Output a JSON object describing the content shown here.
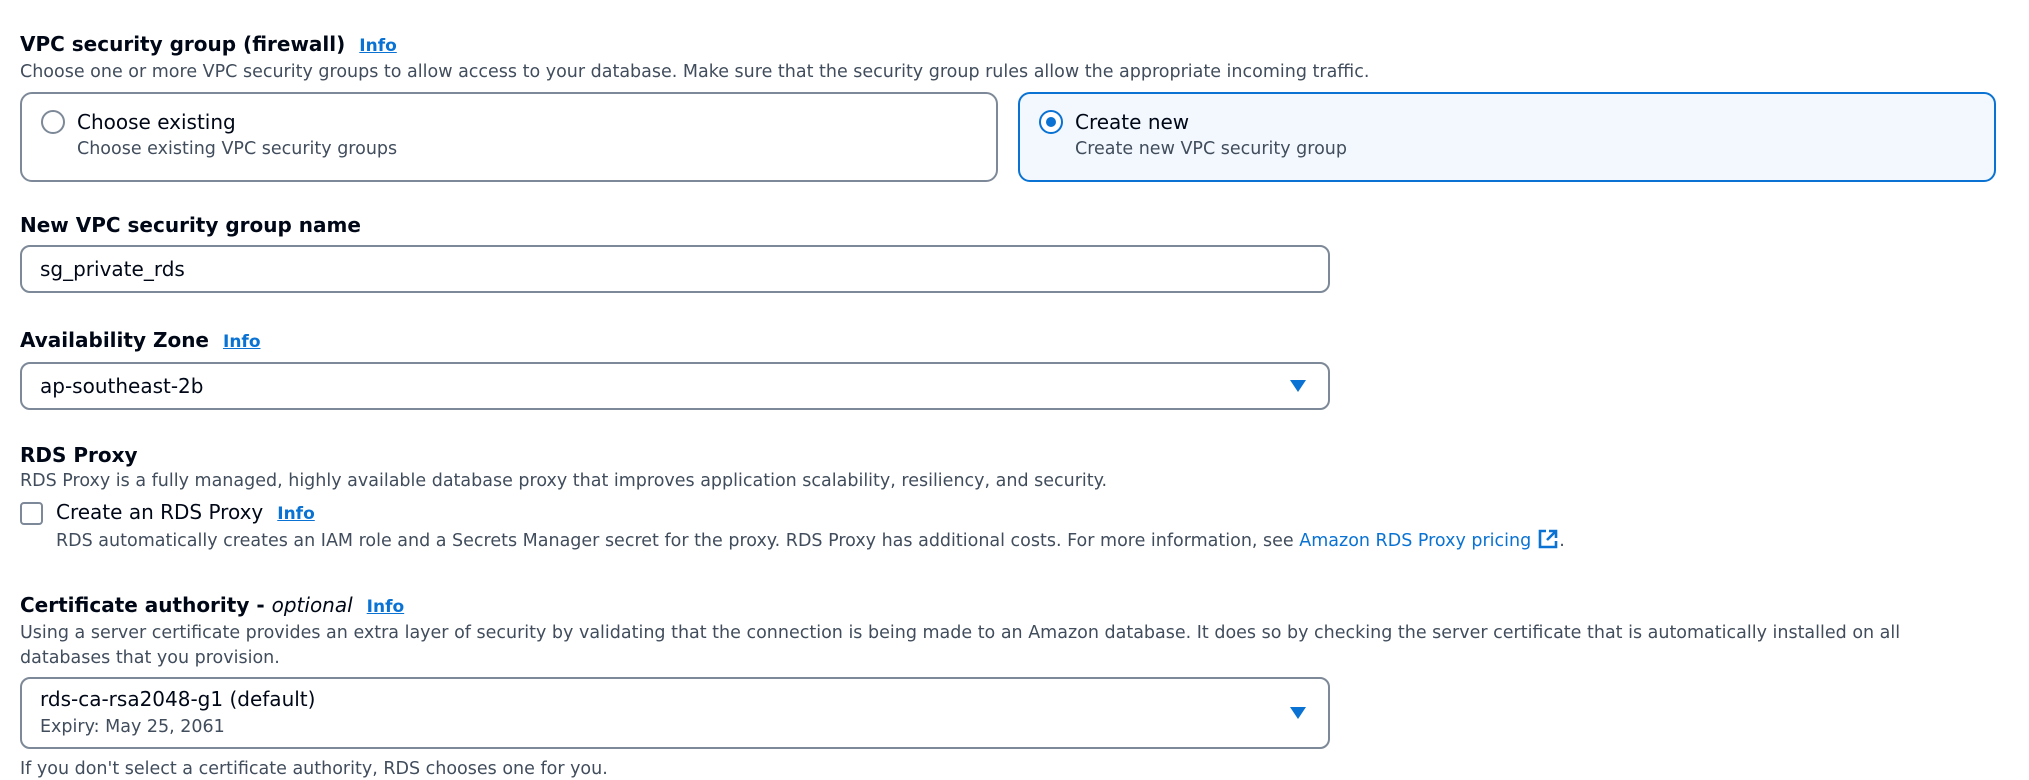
{
  "vpc_sg": {
    "title": "VPC security group (firewall)",
    "info": "Info",
    "description": "Choose one or more VPC security groups to allow access to your database. Make sure that the security group rules allow the appropriate incoming traffic.",
    "options": [
      {
        "title": "Choose existing",
        "subtitle": "Choose existing VPC security groups",
        "selected": false
      },
      {
        "title": "Create new",
        "subtitle": "Create new VPC security group",
        "selected": true
      }
    ]
  },
  "new_sg_name": {
    "label": "New VPC security group name",
    "value": "sg_private_rds"
  },
  "availability_zone": {
    "label": "Availability Zone",
    "info": "Info",
    "value": "ap-southeast-2b"
  },
  "rds_proxy": {
    "title": "RDS Proxy",
    "description": "RDS Proxy is a fully managed, highly available database proxy that improves application scalability, resiliency, and security.",
    "checkbox_label": "Create an RDS Proxy",
    "info": "Info",
    "checked": false,
    "hint": "RDS automatically creates an IAM role and a Secrets Manager secret for the proxy. RDS Proxy has additional costs. For more information, see ",
    "link_text": "Amazon RDS Proxy pricing",
    "hint_end": "."
  },
  "certificate_authority": {
    "label": "Certificate authority - ",
    "label_optional": "optional",
    "info": "Info",
    "description": "Using a server certificate provides an extra layer of security by validating that the connection is being made to an Amazon database. It does so by checking the server certificate that is automatically installed on all databases that you provision.",
    "value": "rds-ca-rsa2048-g1 (default)",
    "value_sub": "Expiry: May 25, 2061",
    "footer": "If you don't select a certificate authority, RDS chooses one for you."
  },
  "colors": {
    "accent": "#0972d3",
    "border": "#7d8998",
    "text": "#000716",
    "muted_text": "#414d5c",
    "selected_bg": "#f2f8fd"
  }
}
